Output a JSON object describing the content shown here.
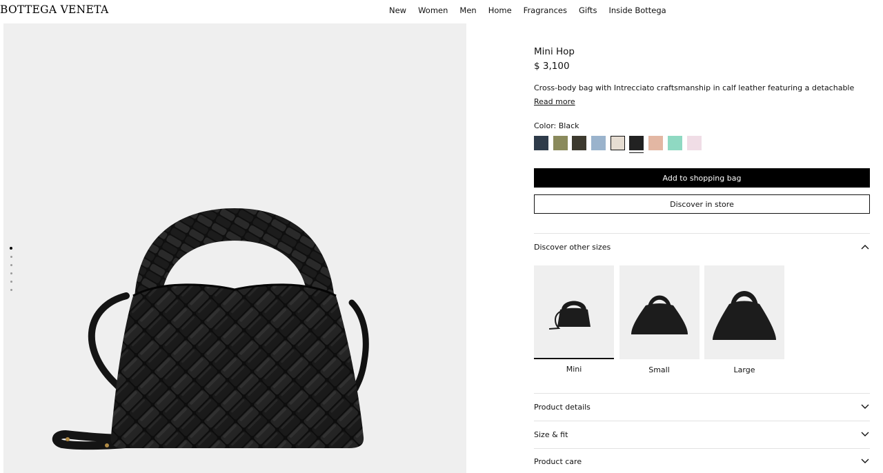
{
  "header": {
    "logo": "BOTTEGA VENETA",
    "nav": [
      "New",
      "Women",
      "Men",
      "Home",
      "Fragrances",
      "Gifts",
      "Inside Bottega"
    ]
  },
  "gallery": {
    "image_count": 6,
    "active_index": 0,
    "image_icon": "woven-black-handbag"
  },
  "product": {
    "title": "Mini Hop",
    "price": "$ 3,100",
    "description": "Cross-body bag with Intrecciato craftsmanship in calf leather featuring a detachable",
    "read_more": "Read more",
    "color_label": "Color: Black",
    "swatches": [
      {
        "name": "navy",
        "color": "#2e3b4a"
      },
      {
        "name": "olive",
        "color": "#8a8a5c"
      },
      {
        "name": "dark-brown",
        "color": "#3d3a2e"
      },
      {
        "name": "light-blue",
        "color": "#9ab3cc"
      },
      {
        "name": "cream",
        "color": "#e6ddd2",
        "outlined": true
      },
      {
        "name": "black",
        "color": "#222222",
        "selected": true
      },
      {
        "name": "peach",
        "color": "#e3b7a3"
      },
      {
        "name": "mint",
        "color": "#8fd9c2"
      },
      {
        "name": "pink",
        "color": "#f0dde6"
      }
    ],
    "add_to_bag": "Add to shopping bag",
    "discover_store": "Discover in store"
  },
  "other_sizes": {
    "label": "Discover other sizes",
    "expanded": true,
    "sizes": [
      {
        "label": "Mini",
        "active": true
      },
      {
        "label": "Small",
        "active": false
      },
      {
        "label": "Large",
        "active": false
      }
    ]
  },
  "accordions": [
    {
      "label": "Product details"
    },
    {
      "label": "Size & fit"
    },
    {
      "label": "Product care"
    }
  ]
}
